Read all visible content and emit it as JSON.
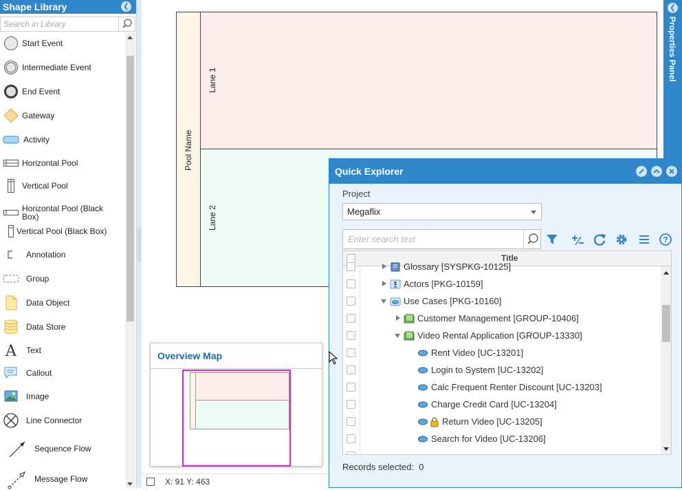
{
  "shape_library": {
    "title": "Shape Library",
    "collapse_glyph": "❮",
    "search_placeholder": "Search in Library",
    "items": [
      {
        "label": "Start Event",
        "icon": "start-event-icon"
      },
      {
        "label": "Intermediate Event",
        "icon": "intermediate-event-icon"
      },
      {
        "label": "End Event",
        "icon": "end-event-icon"
      },
      {
        "label": "Gateway",
        "icon": "gateway-icon"
      },
      {
        "label": "Activity",
        "icon": "activity-icon"
      },
      {
        "label": "Horizontal Pool",
        "icon": "horizontal-pool-icon"
      },
      {
        "label": "Vertical Pool",
        "icon": "vertical-pool-icon"
      },
      {
        "label": "Horizontal Pool (Black Box)",
        "icon": "horizontal-pool-black-box-icon"
      },
      {
        "label": "Vertical Pool (Black Box)",
        "icon": "vertical-pool-black-box-icon"
      },
      {
        "label": "Annotation",
        "icon": "annotation-icon"
      },
      {
        "label": "Group",
        "icon": "group-icon"
      },
      {
        "label": "Data Object",
        "icon": "data-object-icon"
      },
      {
        "label": "Data Store",
        "icon": "data-store-icon"
      },
      {
        "label": "Text",
        "icon": "text-icon"
      },
      {
        "label": "Callout",
        "icon": "callout-icon"
      },
      {
        "label": "Image",
        "icon": "image-icon"
      },
      {
        "label": "Line Connector",
        "icon": "line-connector-icon"
      },
      {
        "label": "Sequence Flow",
        "icon": "sequence-flow-icon"
      },
      {
        "label": "Message Flow",
        "icon": "message-flow-icon"
      }
    ]
  },
  "canvas": {
    "pool_name": "Pool Name",
    "lanes": [
      "Lane 1",
      "Lane 2"
    ]
  },
  "properties_panel": {
    "title": "Properties Panel",
    "expand_glyph": "❮"
  },
  "overview_map": {
    "title": "Overview Map"
  },
  "status_bar": {
    "coords": "X: 91 Y: 463"
  },
  "quick_explorer": {
    "title": "Quick Explorer",
    "project_label": "Project",
    "project_value": "Megaflix",
    "search_placeholder": "Enter search text",
    "column_title": "Title",
    "rows": [
      {
        "label": "Glossary [SYSPKG-10125]",
        "icon": "glossary-icon",
        "expander": "right"
      },
      {
        "label": "Actors [PKG-10159]",
        "icon": "actor-package-icon",
        "expander": "right"
      },
      {
        "label": "Use Cases [PKG-10160]",
        "icon": "use-case-package-icon",
        "expander": "down"
      },
      {
        "label": "Customer Management [GROUP-10406]",
        "icon": "group-folder-icon",
        "expander": "right"
      },
      {
        "label": "Video Rental Application [GROUP-13330]",
        "icon": "group-folder-icon",
        "expander": "down"
      },
      {
        "label": "Rent Video [UC-13201]",
        "icon": "use-case-icon",
        "expander": "none"
      },
      {
        "label": "Login to System [UC-13202]",
        "icon": "use-case-icon",
        "expander": "none"
      },
      {
        "label": "Calc Frequent Renter Discount [UC-13203]",
        "icon": "use-case-icon",
        "expander": "none"
      },
      {
        "label": "Charge Credit Card [UC-13204]",
        "icon": "use-case-icon",
        "expander": "none"
      },
      {
        "label": "Return Video [UC-13205]",
        "icon": "use-case-icon",
        "expander": "none",
        "locked": true
      },
      {
        "label": "Search for Video [UC-13206]",
        "icon": "use-case-icon",
        "expander": "none"
      }
    ],
    "records_selected_label": "Records selected:",
    "records_selected_count": "0"
  },
  "colors": {
    "accent": "#2f86c9",
    "lane1": "#fdeeed",
    "lane2": "#eefbf6",
    "pool_header": "#fdf6e6",
    "overview_frame": "#e01fe0"
  }
}
